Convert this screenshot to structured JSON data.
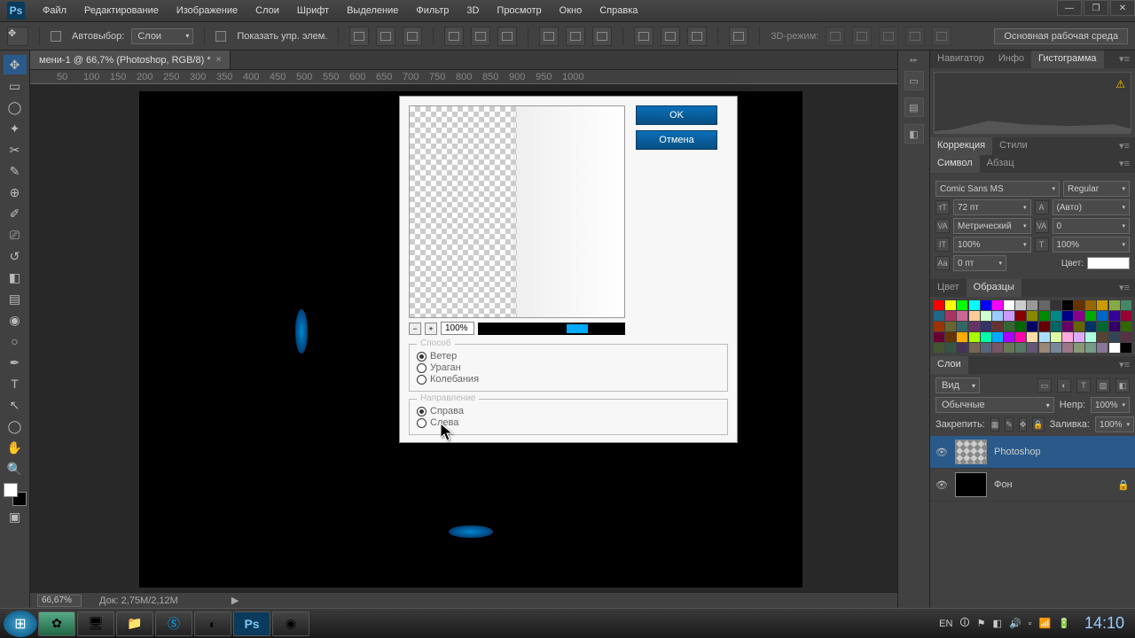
{
  "menubar": {
    "items": [
      "Файл",
      "Редактирование",
      "Изображение",
      "Слои",
      "Шрифт",
      "Выделение",
      "Фильтр",
      "3D",
      "Просмотр",
      "Окно",
      "Справка"
    ]
  },
  "options": {
    "autoselect": "Автовыбор:",
    "layer_dd": "Слои",
    "show_controls": "Показать упр. элем.",
    "mode_3d": "3D-режим:",
    "workspace": "Основная рабочая среда"
  },
  "doc": {
    "tab": "мени-1 @ 66,7% (Photoshop, RGB/8) *"
  },
  "dialog": {
    "ok": "OK",
    "cancel": "Отмена",
    "zoom": "100%",
    "method_label": "Способ",
    "methods": [
      "Ветер",
      "Ураган",
      "Колебания"
    ],
    "direction_label": "Направление",
    "directions": [
      "Справа",
      "Слева"
    ]
  },
  "panels": {
    "nav_tabs": [
      "Навигатор",
      "Инфо",
      "Гистограмма"
    ],
    "adjust_tabs": [
      "Коррекция",
      "Стили"
    ],
    "char_tabs": [
      "Символ",
      "Абзац"
    ],
    "font": "Comic Sans MS",
    "font_style": "Regular",
    "font_size": "72 пт",
    "leading": "(Авто)",
    "kerning": "Метрический",
    "tracking": "0",
    "scale_v": "100%",
    "scale_h": "100%",
    "baseline": "0 пт",
    "color_label": "Цвет:",
    "color_tabs": [
      "Цвет",
      "Образцы"
    ],
    "layers_tab": "Слои",
    "blend_dd": "Вид",
    "blend_mode": "Обычные",
    "opacity_label": "Непр:",
    "opacity": "100%",
    "lock_label": "Закрепить:",
    "fill_label": "Заливка:",
    "fill": "100%",
    "layer1": "Photoshop",
    "layer2": "Фон"
  },
  "status": {
    "zoom": "66,67%",
    "docsize": "Док: 2,75M/2,12M"
  },
  "tray": {
    "lang": "EN",
    "time": "14:10"
  }
}
